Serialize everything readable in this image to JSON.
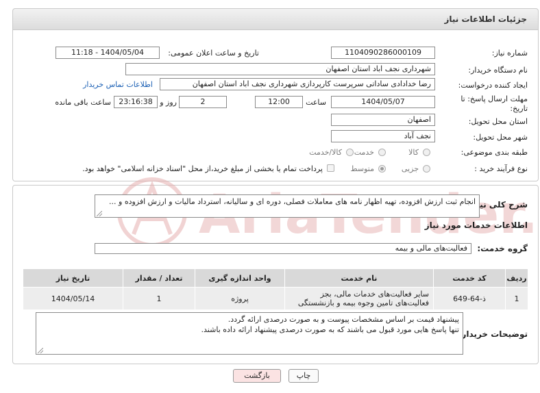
{
  "header": {
    "title": "جزئیات اطلاعات نیاز"
  },
  "need_number": {
    "label": "شماره نیاز:",
    "value": "1104090286000109"
  },
  "announce_datetime": {
    "label": "تاریخ و ساعت اعلان عمومی:",
    "value": "1404/05/04 - 11:18"
  },
  "buyer_org": {
    "label": "نام دستگاه خریدار:",
    "value": "شهرداری نجف اباد استان اصفهان"
  },
  "creator": {
    "label": "ایجاد کننده درخواست:",
    "value": "رضا خدادادی ساداتی سرپرست  کارپردازی شهرداری نجف اباد استان اصفهان",
    "contact_link": "اطلاعات تماس خریدار"
  },
  "deadline": {
    "label": "مهلت ارسال پاسخ: تا تاریخ:",
    "date": "1404/05/07",
    "time_label": "ساعت",
    "time": "12:00",
    "days": "2",
    "days_label": "روز و",
    "remaining": "23:16:38",
    "remaining_label": "ساعت باقی مانده"
  },
  "province": {
    "label": "استان محل تحویل:",
    "value": "اصفهان"
  },
  "city": {
    "label": "شهر محل تحویل:",
    "value": "نجف آباد"
  },
  "category": {
    "label": "طبقه بندی موضوعی:",
    "options": [
      "کالا",
      "خدمت",
      "کالا/خدمت"
    ]
  },
  "process": {
    "label": "نوع فرآیند خرید :",
    "options": [
      "جزیی",
      "متوسط"
    ],
    "payment_note": "پرداخت تمام یا بخشی از مبلغ خرید،از محل \"اسناد خزانه اسلامی\" خواهد بود."
  },
  "summary": {
    "label": "شرح کلی نیاز:",
    "value": "انجام ثبت ارزش افزوده، تهیه اظهار نامه های معاملات فصلی، دوره ای و سالیانه، استرداد مالیات و ارزش افزوده و ..."
  },
  "services_section": {
    "title": "اطلاعات خدمات مورد نیاز"
  },
  "service_group": {
    "label": "گروه خدمت:",
    "value": "فعالیت‌های مالی و بیمه"
  },
  "table": {
    "headers": [
      "ردیف",
      "کد خدمت",
      "نام خدمت",
      "واحد اندازه گیری",
      "تعداد / مقدار",
      "تاریخ نیاز"
    ],
    "rows": [
      [
        "1",
        "ذ-64-649",
        "سایر فعالیت‌های خدمات مالی، بجز فعالیت‌های تامین وجوه بیمه و بازنشستگی",
        "پروژه",
        "1",
        "1404/05/14"
      ]
    ]
  },
  "buyer_notes": {
    "label": "توضیحات خریدار:",
    "line1": "پیشنهاد قیمت بر اساس مشخصات پیوست و به صورت درصدی ارائه گردد.",
    "line2": "تنها پاسخ هایی مورد قبول می باشند که به صورت درصدی پیشنهاد ارائه داده باشند."
  },
  "buttons": {
    "print": "چاپ",
    "back": "بازگشت"
  },
  "watermark": {
    "text": "AriaTender.neT"
  },
  "colors": {
    "link": "#1a5fb4",
    "back_button": "#fbe3e3",
    "watermark": "#e6b0b0"
  }
}
